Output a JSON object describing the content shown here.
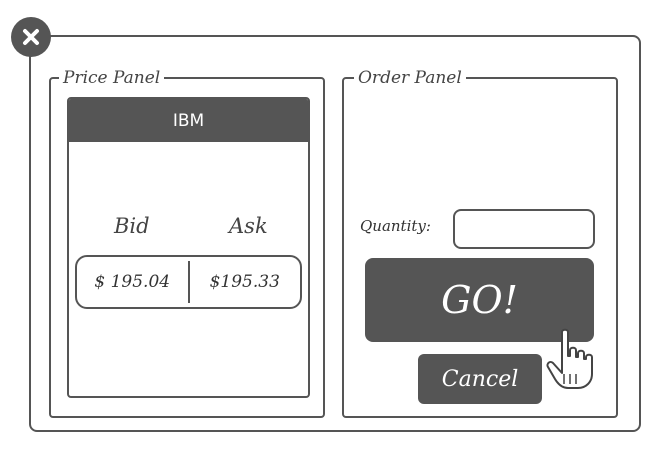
{
  "price_panel": {
    "legend": "Price Panel",
    "ticker": "IBM",
    "bid_label": "Bid",
    "ask_label": "Ask",
    "bid_value": "$ 195.04",
    "ask_value": "$195.33"
  },
  "order_panel": {
    "legend": "Order Panel",
    "quantity_label": "Quantity:",
    "quantity_value": "",
    "go_label": "GO!",
    "cancel_label": "Cancel"
  },
  "icons": {
    "close": "close-icon",
    "cursor": "hand-cursor-icon"
  },
  "colors": {
    "ink": "#555555",
    "background": "#ffffff"
  }
}
